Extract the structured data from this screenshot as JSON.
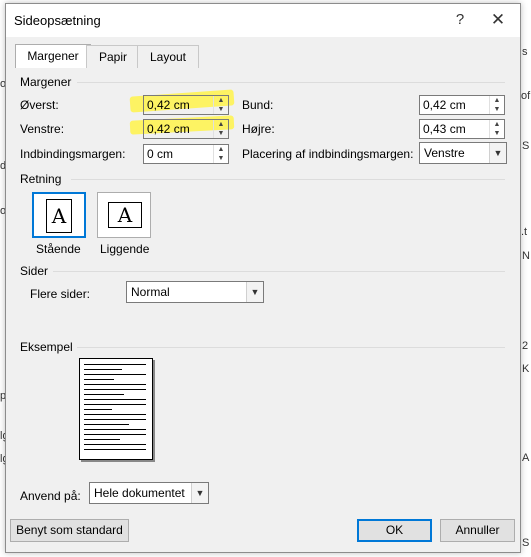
{
  "window": {
    "title": "Sideopsætning",
    "help_glyph": "?",
    "close_glyph": "✕"
  },
  "tabs": [
    {
      "label": "Margener",
      "active": true
    },
    {
      "label": "Papir",
      "active": false
    },
    {
      "label": "Layout",
      "active": false
    }
  ],
  "margins": {
    "group_title": "Margener",
    "top": {
      "label": "Øverst:",
      "value": "0,42 cm"
    },
    "left": {
      "label": "Venstre:",
      "value": "0,42 cm"
    },
    "gutter": {
      "label": "Indbindingsmargen:",
      "value": "0 cm"
    },
    "bottom": {
      "label": "Bund:",
      "value": "0,42 cm"
    },
    "right": {
      "label": "Højre:",
      "value": "0,43 cm"
    },
    "gutter_pos": {
      "label": "Placering af indbindingsmargen:",
      "value": "Venstre"
    }
  },
  "orientation": {
    "group_title": "Retning",
    "glyph": "A",
    "portrait_label": "Stående",
    "landscape_label": "Liggende",
    "selected": "portrait"
  },
  "pages": {
    "group_title": "Sider",
    "multiple_label": "Flere sider:",
    "multiple_value": "Normal"
  },
  "preview": {
    "group_title": "Eksempel"
  },
  "apply": {
    "label": "Anvend på:",
    "value": "Hele dokumentet"
  },
  "buttons": {
    "default_label": "Benyt som standard",
    "ok_label": "OK",
    "cancel_label": "Annuller"
  },
  "background": {
    "right_edge": [
      "s",
      "of",
      "S",
      ".t",
      "N",
      "2",
      "K",
      "A",
      "S"
    ],
    "left_edge": [
      "o",
      "d",
      "or",
      "p",
      "lg",
      "lg"
    ]
  },
  "colors": {
    "accent": "#0078d7",
    "highlight": "#fff34a"
  }
}
